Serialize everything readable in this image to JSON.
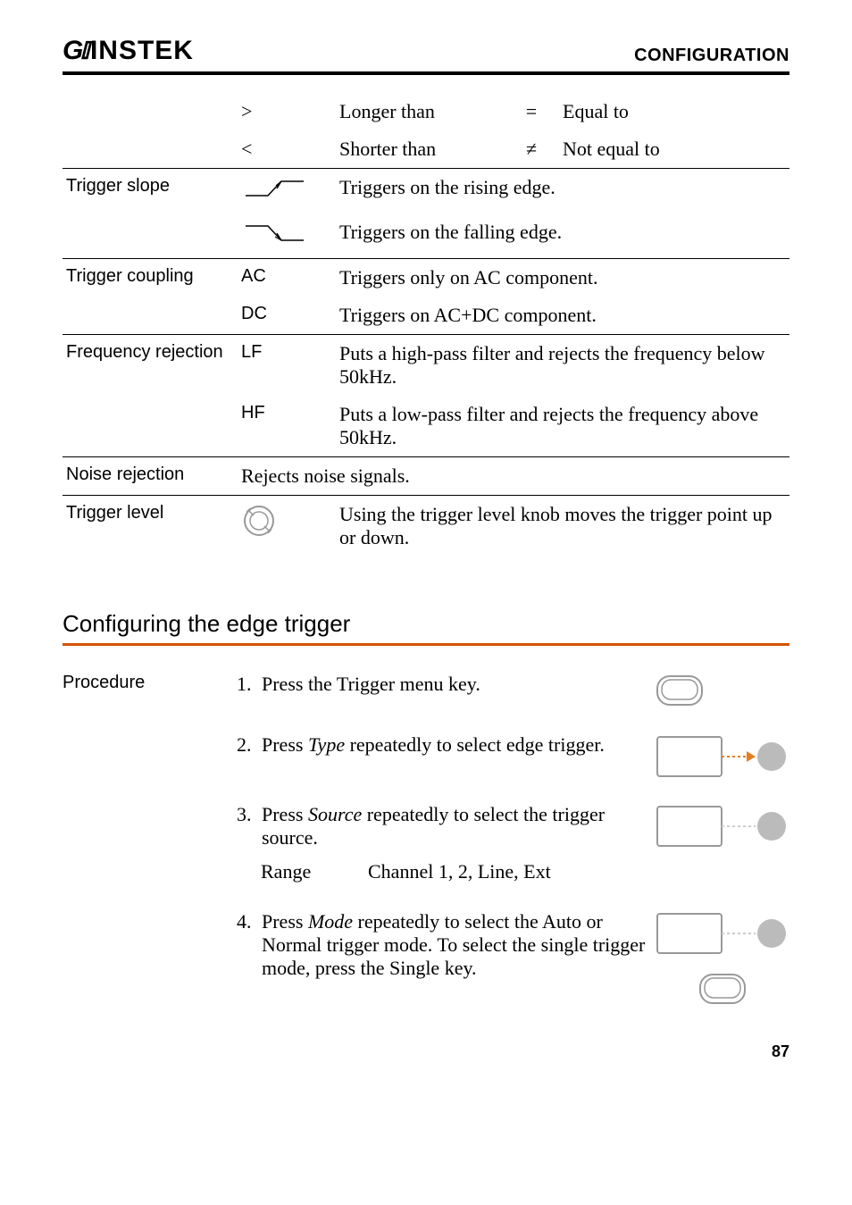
{
  "header": {
    "logo": "GWINSTEK",
    "chapter_title": "CONFIGURATION"
  },
  "symbol_table": {
    "operators": [
      {
        "sym": ">",
        "meaning": "Longer than",
        "sym2": "=",
        "meaning2": "Equal to"
      },
      {
        "sym": "<",
        "meaning": "Shorter than",
        "sym2": "≠",
        "meaning2": "Not equal to"
      }
    ]
  },
  "trigger_slope": {
    "label": "Trigger slope",
    "rising": "Triggers on the rising edge.",
    "falling": "Triggers on the falling edge."
  },
  "trigger_coupling": {
    "label": "Trigger coupling",
    "rows": [
      {
        "code": "AC",
        "desc": "Triggers only on AC component."
      },
      {
        "code": "DC",
        "desc": "Triggers on AC+DC component."
      }
    ]
  },
  "frequency_rejection": {
    "label": "Frequency rejection",
    "rows": [
      {
        "code": "LF",
        "desc": "Puts a high-pass filter and rejects the frequency below 50kHz."
      },
      {
        "code": "HF",
        "desc": "Puts a low-pass filter and rejects the frequency above 50kHz."
      }
    ]
  },
  "noise_rejection": {
    "label": "Noise rejection",
    "desc": "Rejects noise signals."
  },
  "trigger_level": {
    "label": "Trigger level",
    "desc": "Using the trigger level knob moves the trigger point up or down."
  },
  "section": {
    "heading": "Configuring the edge trigger"
  },
  "procedure": {
    "label": "Procedure",
    "steps": [
      {
        "num": "1.",
        "text": "Press the Trigger menu key."
      },
      {
        "num": "2.",
        "text_pre": "Press ",
        "text_em": "Type",
        "text_post": " repeatedly to select edge trigger."
      },
      {
        "num": "3.",
        "text_pre": "Press ",
        "text_em": "Source",
        "text_post": " repeatedly to select the trigger source."
      },
      {
        "num": "4.",
        "text_pre": "Press ",
        "text_em": "Mode",
        "text_post": " repeatedly to select the Auto or Normal trigger mode. To select the single trigger mode, press the Single key."
      }
    ],
    "range_label": "Range",
    "range_value": "Channel 1, 2, Line, Ext"
  },
  "page_number": "87"
}
